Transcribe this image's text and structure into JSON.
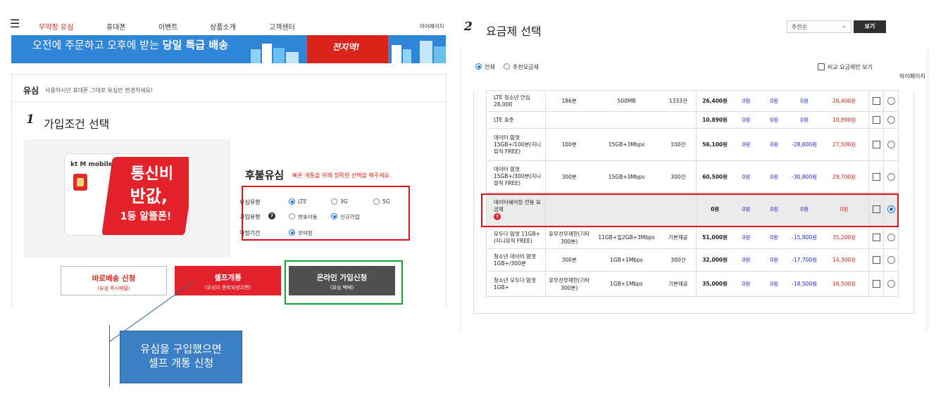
{
  "left": {
    "nav": {
      "menu_icon": "hamburger-icon",
      "items": [
        "무약정 유심",
        "휴대폰",
        "이벤트",
        "상품소개",
        "고객센터"
      ],
      "mypage": "마이페이지"
    },
    "banner": {
      "text": "오전에 주문하고 오후에 받는",
      "text_bold": "당일 특급 배송",
      "badge": "전지역!"
    },
    "sim": {
      "title": "유심",
      "desc": "사용하시던 휴대폰 그대로 유심만 변경하세요!"
    },
    "step1": {
      "num": "1",
      "title": "가입조건 선택"
    },
    "card": {
      "brand": "kt M mobile",
      "promo_l1": "통신비",
      "promo_l2": "반값,",
      "promo_l3": "1등 알뜰폰!"
    },
    "postpaid": {
      "title": "후불유심",
      "note": "빠른 개통을 위해 정확한 선택을 해주세요.",
      "sim_type_label": "유심유형",
      "sim_types": [
        "LTE",
        "3G",
        "5G"
      ],
      "join_type_label": "가입유형",
      "join_types": [
        "번호이동",
        "신규가입"
      ],
      "contract_label": "약정기간",
      "contract_value": "무약정"
    },
    "buttons": {
      "direct_main": "바로배송 신청",
      "direct_sub": "(유심 즉시배달)",
      "self_main": "셀프개통",
      "self_sub": "(유심이 준비되셨으면)",
      "online_main": "온라인 가입신청",
      "online_sub": "(유심 택배)"
    },
    "callout": {
      "line1": "유심을 구입했으면",
      "line2": "셀프 개통 신청"
    }
  },
  "right": {
    "step2": {
      "num": "2",
      "title": "요금제 선택"
    },
    "sort": {
      "value": "추천순",
      "view_button": "보기"
    },
    "filters": [
      "전체",
      "추천요금제"
    ],
    "compare_label": "비교 요금제만 보기",
    "mypage": "마이페이지",
    "plans": [
      {
        "name": "LTE 청소년 안심 28,000",
        "voice": "186분",
        "data": "500MB",
        "sms": "1333건",
        "price": "26,400원",
        "d1": "0원",
        "d2": "0원",
        "d3": "0원",
        "final": "26,400원"
      },
      {
        "name": "LTE 표준",
        "voice": "",
        "data": "",
        "sms": "",
        "price": "10,890원",
        "d1": "0원",
        "d2": "0원",
        "d3": "0원",
        "final": "10,890원"
      },
      {
        "name": "데이터 맘껏 15GB+/100분(지니뮤직 FREE)",
        "voice": "100분",
        "data": "15GB+3Mbps",
        "sms": "100건",
        "price": "56,100원",
        "d1": "0원",
        "d2": "0원",
        "d3": "-28,600원",
        "final": "27,500원"
      },
      {
        "name": "데이터 맘껏 15GB+/300분(지니뮤직 FREE)",
        "voice": "300분",
        "data": "15GB+3Mbps",
        "sms": "300건",
        "price": "60,500원",
        "d1": "0원",
        "d2": "0원",
        "d3": "-30,800원",
        "final": "29,700원"
      },
      {
        "name": "데이터쉐어링 전용 요금제",
        "voice": "",
        "data": "",
        "sms": "",
        "price": "0원",
        "d1": "0원",
        "d2": "0원",
        "d3": "0원",
        "final": "0원"
      },
      {
        "name": "모두다 맘껏 11GB+(지니뮤직 FREE)",
        "voice": "유무선무제한(기타300분)",
        "data": "11GB+일2GB+3Mbps",
        "sms": "기본제공",
        "price": "51,000원",
        "d1": "0원",
        "d2": "0원",
        "d3": "-15,800원",
        "final": "35,200원"
      },
      {
        "name": "청소년 데이터 맘껏 1GB+/300분",
        "voice": "300분",
        "data": "1GB+1Mbps",
        "sms": "300건",
        "price": "32,000원",
        "d1": "0원",
        "d2": "0원",
        "d3": "-17,700원",
        "final": "14,300원"
      },
      {
        "name": "청소년 모두다 맘껏 1GB+",
        "voice": "유무선무제한(기타300분)",
        "data": "1GB+1Mbps",
        "sms": "기본제공",
        "price": "35,000원",
        "d1": "0원",
        "d2": "0원",
        "d3": "-18,500원",
        "final": "16,500원"
      }
    ],
    "selected_plan_index": 4,
    "help_mark": "?"
  }
}
